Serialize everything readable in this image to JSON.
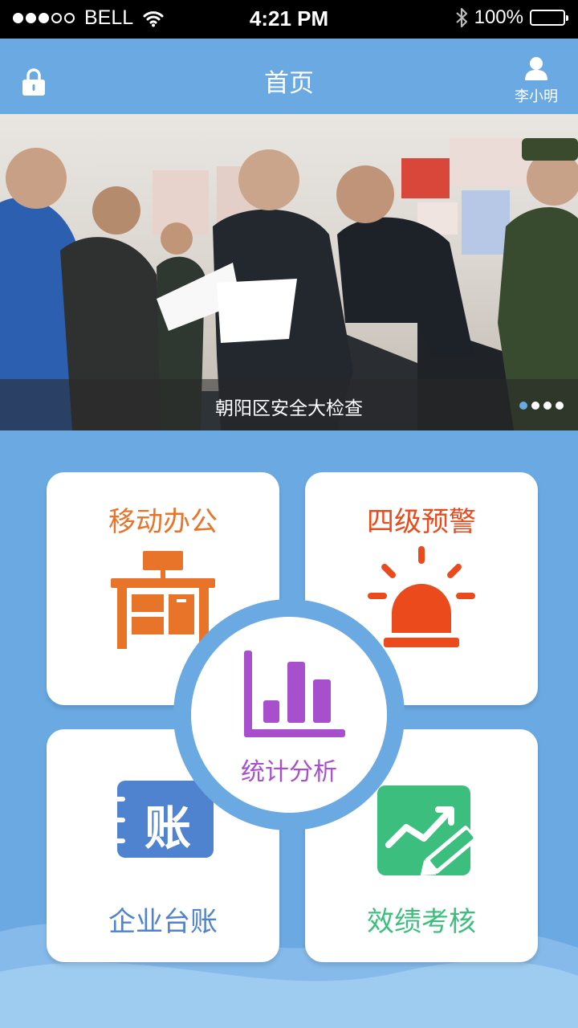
{
  "status_bar": {
    "carrier": "BELL",
    "time": "4:21 PM",
    "battery": "100%"
  },
  "nav": {
    "title": "首页",
    "user_name": "李小明"
  },
  "banner": {
    "caption": "朝阳区安全大检查",
    "page_count": 4,
    "active_page": 1
  },
  "tiles": {
    "mobile_office": {
      "label": "移动办公",
      "color": "#e8742a"
    },
    "warning": {
      "label": "四级预警",
      "color": "#ea4a1c"
    },
    "statistics": {
      "label": "统计分析",
      "color": "#a84fce"
    },
    "ledger": {
      "label": "企业台账",
      "icon_text": "账",
      "color": "#4f82cf"
    },
    "performance": {
      "label": "效绩考核",
      "color": "#3cbf7e"
    }
  },
  "colors": {
    "accent": "#6aa9e2",
    "status_bar": "#000000"
  }
}
